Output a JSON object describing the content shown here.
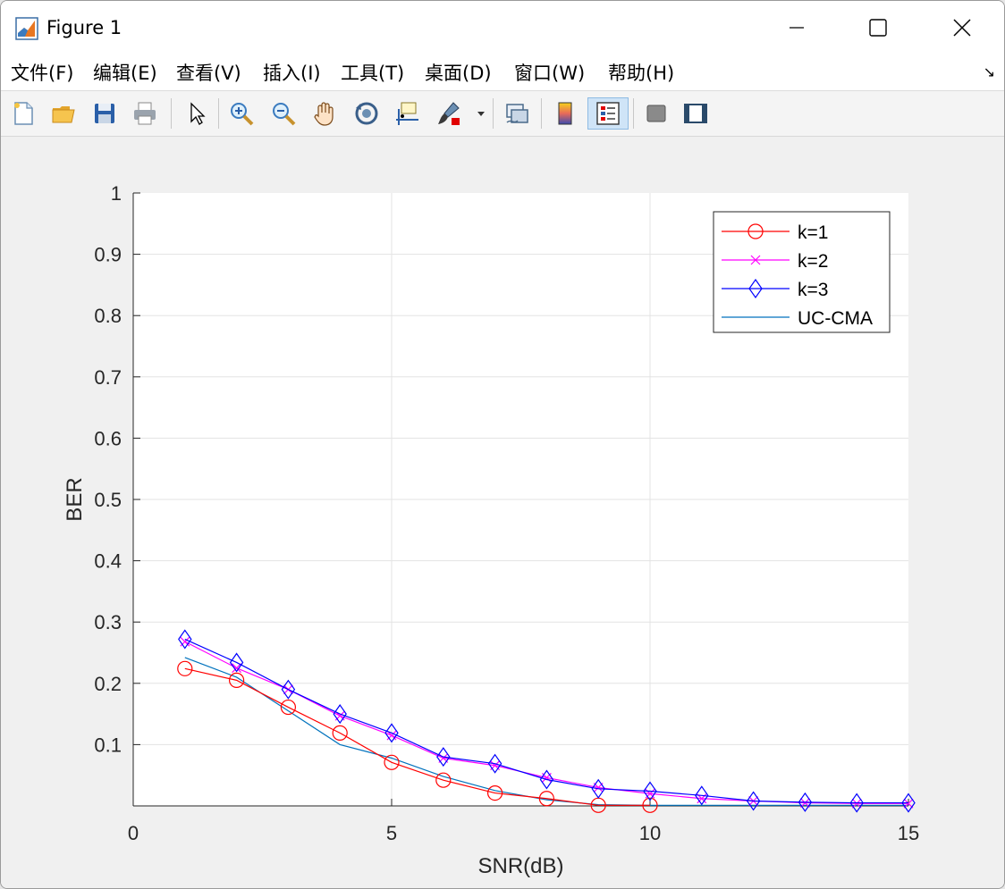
{
  "window": {
    "title": "Figure 1",
    "minimize_glyph": "—",
    "maximize_glyph": "☐",
    "close_glyph": "✕"
  },
  "menu": {
    "items": [
      "文件(F)",
      "编辑(E)",
      "查看(V)",
      "插入(I)",
      "工具(T)",
      "桌面(D)",
      "窗口(W)",
      "帮助(H)"
    ],
    "overflow_glyph": "↘"
  },
  "toolbar": {
    "icons": [
      "new-figure-icon",
      "open-file-icon",
      "save-icon",
      "print-icon",
      "select-pointer-icon",
      "zoom-in-icon",
      "zoom-out-icon",
      "pan-hand-icon",
      "rotate-3d-icon",
      "data-cursor-icon",
      "brush-icon",
      "link-plot-icon",
      "colorbar-icon",
      "legend-icon",
      "hide-plot-tools-icon",
      "show-plot-tools-icon"
    ]
  },
  "chart_data": {
    "type": "line",
    "title": "",
    "xlabel": "SNR(dB)",
    "ylabel": "BER",
    "xlim": [
      0,
      15
    ],
    "ylim": [
      0,
      1
    ],
    "xticks": [
      "0",
      "5",
      "10",
      "15"
    ],
    "xtick_values": [
      0,
      5,
      10,
      15
    ],
    "yticks": [
      "0.1",
      "0.2",
      "0.3",
      "0.4",
      "0.5",
      "0.6",
      "0.7",
      "0.8",
      "0.9",
      "1"
    ],
    "ytick_values": [
      0.1,
      0.2,
      0.3,
      0.4,
      0.5,
      0.6,
      0.7,
      0.8,
      0.9,
      1.0
    ],
    "grid": true,
    "legend_position": "top-right",
    "series": [
      {
        "name": "k=1",
        "color": "#ff0000",
        "marker": "circle",
        "x": [
          1,
          2,
          3,
          4,
          5,
          6,
          7,
          8,
          9,
          10
        ],
        "y": [
          0.224,
          0.205,
          0.161,
          0.119,
          0.071,
          0.042,
          0.021,
          0.012,
          0.001,
          0.001
        ]
      },
      {
        "name": "k=2",
        "color": "#ff00ff",
        "marker": "x",
        "x": [
          1,
          2,
          3,
          4,
          5,
          6,
          7,
          8,
          9,
          10,
          11,
          12,
          13,
          14,
          15
        ],
        "y": [
          0.268,
          0.225,
          0.19,
          0.147,
          0.115,
          0.078,
          0.066,
          0.046,
          0.03,
          0.02,
          0.012,
          0.008,
          0.005,
          0.004,
          0.004
        ]
      },
      {
        "name": "k=3",
        "color": "#0000ff",
        "marker": "diamond",
        "x": [
          1,
          2,
          3,
          4,
          5,
          6,
          7,
          8,
          9,
          10,
          11,
          12,
          13,
          14,
          15
        ],
        "y": [
          0.272,
          0.234,
          0.19,
          0.15,
          0.119,
          0.08,
          0.069,
          0.043,
          0.028,
          0.024,
          0.017,
          0.008,
          0.006,
          0.005,
          0.005
        ]
      },
      {
        "name": "UC-CMA",
        "color": "#0072bd",
        "marker": "none",
        "x": [
          1,
          2,
          3,
          4,
          5,
          6,
          7,
          8,
          9,
          10,
          11,
          12,
          13,
          14,
          15
        ],
        "y": [
          0.242,
          0.21,
          0.155,
          0.1,
          0.078,
          0.048,
          0.025,
          0.01,
          0.002,
          0.001,
          0.001,
          0.001,
          0.001,
          0.001,
          0.001
        ]
      }
    ]
  }
}
